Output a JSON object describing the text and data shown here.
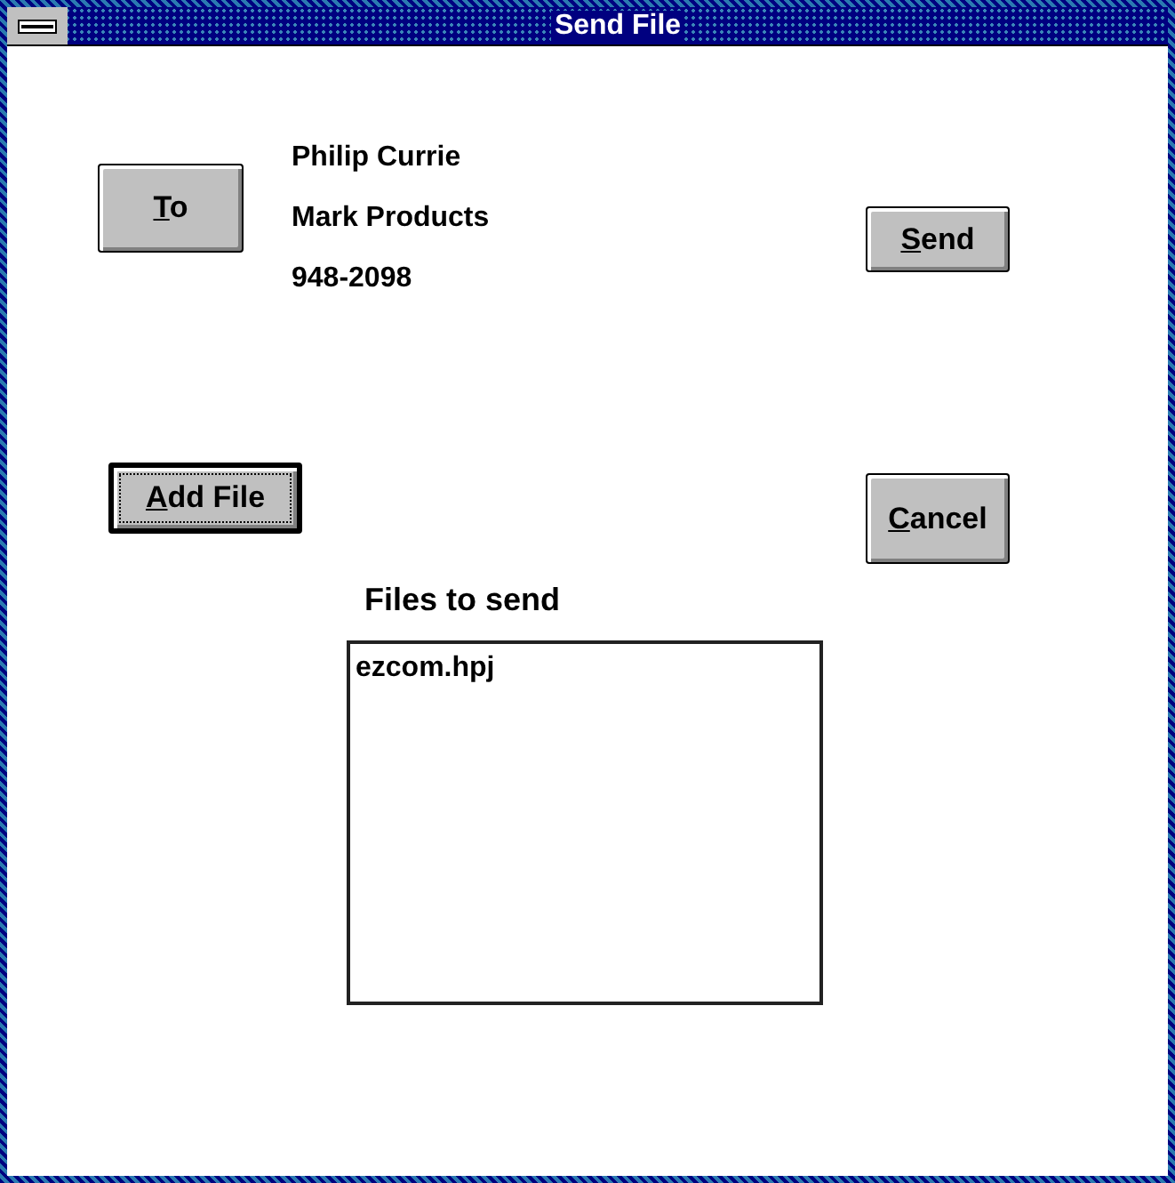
{
  "window": {
    "title": "Send File"
  },
  "to_button": {
    "label": "To",
    "default": false
  },
  "recipient": [
    "Philip Currie",
    "Mark Products",
    "948-2098"
  ],
  "send_button": {
    "label": "Send",
    "default": false
  },
  "add_file_button": {
    "label": "Add File",
    "default": true
  },
  "cancel_button": {
    "label": "Cancel",
    "default": false
  },
  "files_list": {
    "label": "Files to send",
    "items": [
      "ezcom.hpj"
    ]
  }
}
